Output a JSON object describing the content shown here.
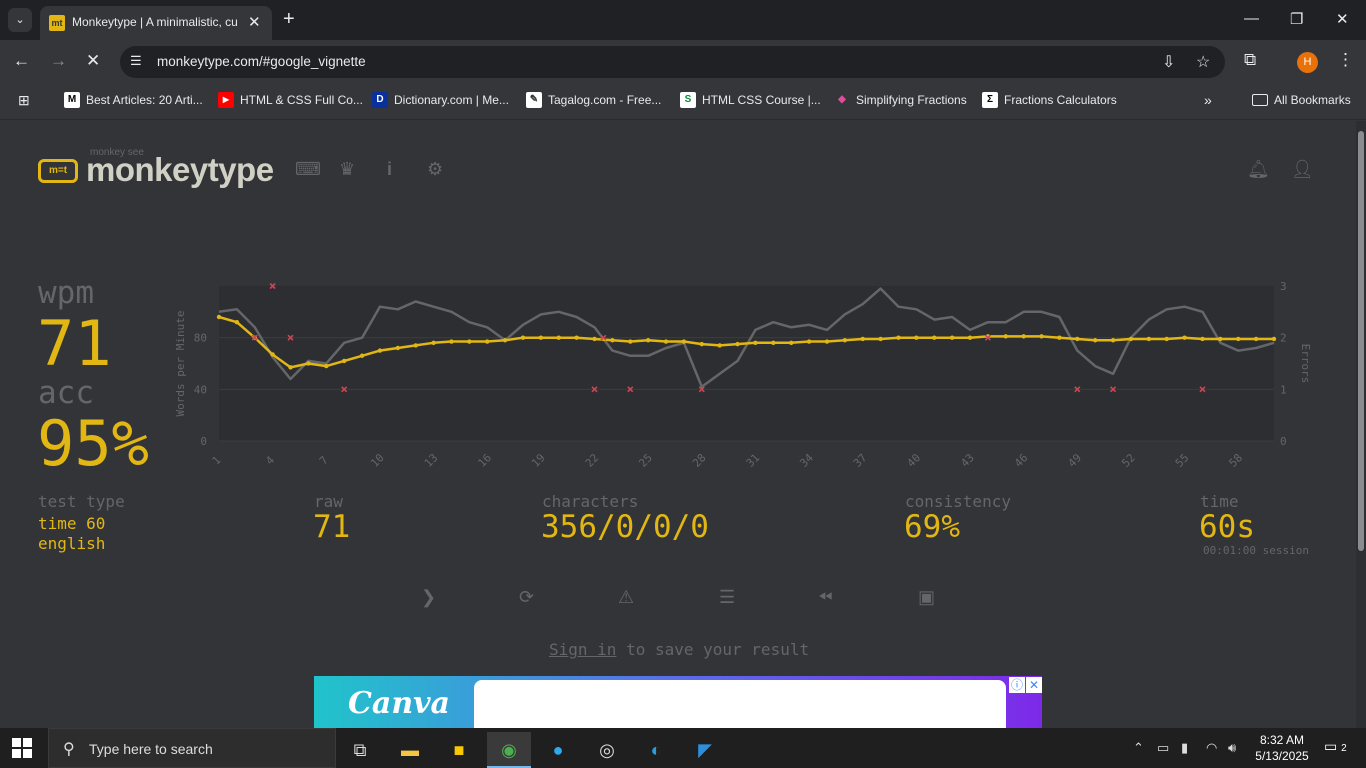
{
  "browser": {
    "tab_title": "Monkeytype | A minimalistic, cu",
    "tab_favicon": "mt",
    "url": "monkeytype.com/#google_vignette",
    "profile_initial": "H",
    "bookmarks": [
      {
        "label": "Best Articles: 20 Arti...",
        "icon": "M"
      },
      {
        "label": "HTML & CSS Full Co...",
        "icon": "▶"
      },
      {
        "label": "Dictionary.com | Me...",
        "icon": "D"
      },
      {
        "label": "Tagalog.com - Free...",
        "icon": "✎"
      },
      {
        "label": "HTML CSS Course |...",
        "icon": "S"
      },
      {
        "label": "Simplifying Fractions",
        "icon": "◆"
      },
      {
        "label": "Fractions Calculators",
        "icon": "Σ"
      }
    ],
    "all_bookmarks": "All Bookmarks"
  },
  "header": {
    "logo_sub": "monkey see",
    "logo_text": "monkeytype"
  },
  "results": {
    "wpm_label": "wpm",
    "wpm_value": "71",
    "acc_label": "acc",
    "acc_value": "95%",
    "test_type_label": "test type",
    "test_type_line1": "time 60",
    "test_type_line2": "english",
    "raw_label": "raw",
    "raw_value": "71",
    "characters_label": "characters",
    "characters_value": "356/0/0/0",
    "consistency_label": "consistency",
    "consistency_value": "69%",
    "time_label": "time",
    "time_value": "60s",
    "session_text": "00:01:00 session"
  },
  "signin": {
    "link": "Sign in",
    "rest": " to save your result"
  },
  "ad": {
    "logo": "Canva"
  },
  "taskbar": {
    "search_placeholder": "Type here to search",
    "time": "8:32 AM",
    "date": "5/13/2025",
    "notifications": "2"
  },
  "colors": {
    "accent": "#e2b714",
    "raw_line": "#646669",
    "error": "#ca4754",
    "background": "#323437"
  },
  "chart_data": {
    "type": "line",
    "ylabel": "Words per Minute",
    "y2label": "Errors",
    "ylim": [
      0,
      120
    ],
    "y2lim": [
      0,
      3
    ],
    "yticks": [
      "0",
      "40",
      "80"
    ],
    "y2ticks": [
      "0",
      "1",
      "2",
      "3"
    ],
    "x_ticks": [
      "1",
      "4",
      "7",
      "10",
      "13",
      "16",
      "19",
      "22",
      "25",
      "28",
      "31",
      "34",
      "37",
      "40",
      "43",
      "46",
      "49",
      "52",
      "55",
      "58"
    ],
    "x": [
      1,
      2,
      3,
      4,
      5,
      6,
      7,
      8,
      9,
      10,
      11,
      12,
      13,
      14,
      15,
      16,
      17,
      18,
      19,
      20,
      21,
      22,
      23,
      24,
      25,
      26,
      27,
      28,
      29,
      30,
      31,
      32,
      33,
      34,
      35,
      36,
      37,
      38,
      39,
      40,
      41,
      42,
      43,
      44,
      45,
      46,
      47,
      48,
      49,
      50,
      51,
      52,
      53,
      54,
      55,
      56,
      57,
      58,
      59,
      60
    ],
    "series": [
      {
        "values": [
          96,
          92,
          80,
          67,
          57,
          60,
          58,
          62,
          66,
          70,
          72,
          74,
          76,
          77,
          77,
          77,
          78,
          80,
          80,
          80,
          80,
          79,
          78,
          77,
          78,
          77,
          77,
          75,
          74,
          75,
          76,
          76,
          76,
          77,
          77,
          78,
          79,
          79,
          80,
          80,
          80,
          80,
          80,
          81,
          81,
          81,
          81,
          80,
          79,
          78,
          78,
          79,
          79,
          79,
          80,
          79,
          79,
          79,
          79,
          79
        ],
        "color": "#e2b714"
      },
      {
        "values": [
          100,
          102,
          88,
          65,
          48,
          62,
          60,
          76,
          80,
          104,
          102,
          108,
          104,
          100,
          92,
          88,
          78,
          90,
          98,
          100,
          96,
          88,
          70,
          66,
          66,
          72,
          76,
          42,
          52,
          62,
          86,
          92,
          88,
          90,
          86,
          98,
          106,
          118,
          104,
          102,
          94,
          96,
          86,
          92,
          92,
          100,
          100,
          96,
          70,
          58,
          52,
          80,
          94,
          102,
          104,
          100,
          76,
          70,
          72,
          76
        ],
        "color": "#646669"
      }
    ],
    "errors": [
      {
        "x": 4,
        "y": 3
      },
      {
        "x": 3,
        "y": 2
      },
      {
        "x": 5,
        "y": 2
      },
      {
        "x": 8,
        "y": 1
      },
      {
        "x": 22,
        "y": 1
      },
      {
        "x": 22.5,
        "y": 2
      },
      {
        "x": 24,
        "y": 1
      },
      {
        "x": 28,
        "y": 1
      },
      {
        "x": 44,
        "y": 2
      },
      {
        "x": 49,
        "y": 1
      },
      {
        "x": 51,
        "y": 1
      },
      {
        "x": 56,
        "y": 1
      }
    ]
  }
}
